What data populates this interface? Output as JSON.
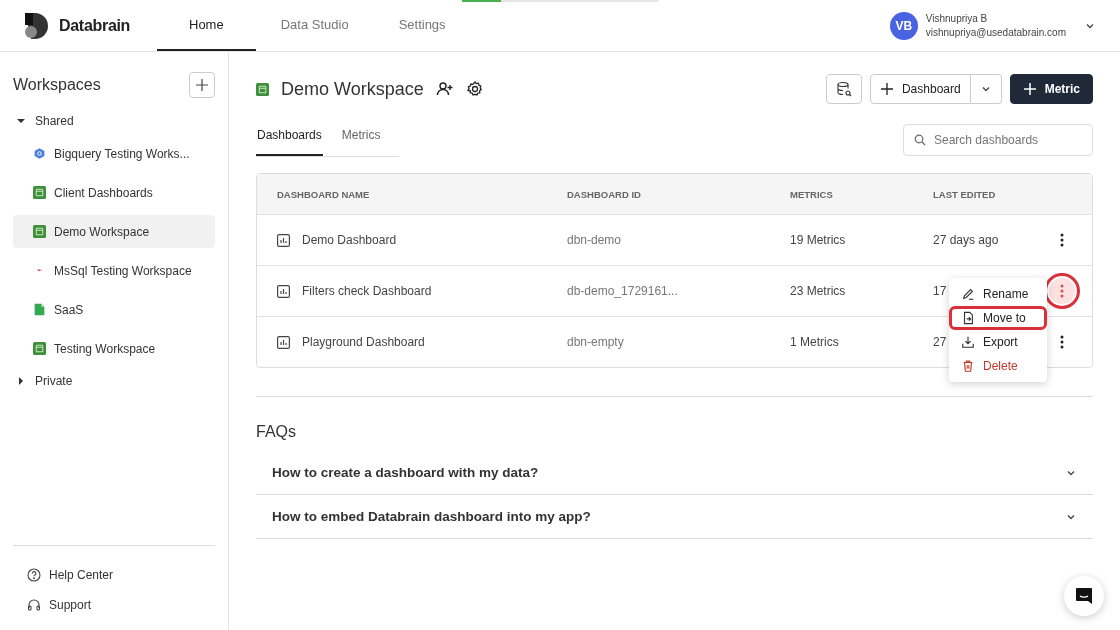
{
  "brand": {
    "name": "Databrain"
  },
  "nav": [
    {
      "label": "Home",
      "selected": true
    },
    {
      "label": "Data Studio",
      "selected": false
    },
    {
      "label": "Settings",
      "selected": false
    }
  ],
  "user": {
    "initials": "VB",
    "name": "Vishnupriya B",
    "email": "vishnupriya@usedatabrain.com"
  },
  "sidebar": {
    "title": "Workspaces",
    "groups": [
      {
        "label": "Shared",
        "expanded": true,
        "children": [
          {
            "label": "Bigquery Testing Works...",
            "kind": "bigquery",
            "selected": false
          },
          {
            "label": "Client Dashboards",
            "kind": "database",
            "selected": false
          },
          {
            "label": "Demo Workspace",
            "kind": "database",
            "selected": true
          },
          {
            "label": "MsSql Testing Workspace",
            "kind": "mssql",
            "selected": false
          },
          {
            "label": "SaaS",
            "kind": "csv",
            "selected": false
          },
          {
            "label": "Testing Workspace",
            "kind": "database",
            "selected": false
          }
        ]
      },
      {
        "label": "Private",
        "expanded": false
      }
    ],
    "footer": [
      {
        "label": "Help Center",
        "kind": "help"
      },
      {
        "label": "Support",
        "kind": "support"
      }
    ]
  },
  "workspace": {
    "title": "Demo Workspace",
    "new_dashboard": "Dashboard",
    "new_metric": "Metric"
  },
  "tabs": [
    {
      "label": "Dashboards",
      "selected": true
    },
    {
      "label": "Metrics",
      "selected": false
    }
  ],
  "search": {
    "placeholder": "Search dashboards"
  },
  "table": {
    "columns": [
      "DASHBOARD NAME",
      "DASHBOARD ID",
      "METRICS",
      "LAST EDITED"
    ],
    "rows": [
      {
        "name": "Demo Dashboard",
        "id": "dbn-demo",
        "metrics": "19 Metrics",
        "last_edited": "27 days ago",
        "menu_annotated": false
      },
      {
        "name": "Filters check Dashboard",
        "id": "db-demo_1729161...",
        "metrics": "23 Metrics",
        "last_edited": "17",
        "menu_annotated": true
      },
      {
        "name": "Playground Dashboard",
        "id": "dbn-empty",
        "metrics": "1 Metrics",
        "last_edited": "27",
        "menu_annotated": false
      }
    ]
  },
  "context_menu": {
    "items": [
      {
        "label": "Rename",
        "kind": "rename",
        "annotated": false
      },
      {
        "label": "Move to",
        "kind": "move",
        "annotated": true
      },
      {
        "label": "Export",
        "kind": "export",
        "annotated": false
      },
      {
        "label": "Delete",
        "kind": "delete",
        "annotated": false
      }
    ]
  },
  "faqs": {
    "title": "FAQs",
    "items": [
      {
        "question": "How to create a dashboard with my data?",
        "expanded": false
      },
      {
        "question": "How to embed Databrain dashboard into my app?",
        "expanded": false
      }
    ]
  }
}
